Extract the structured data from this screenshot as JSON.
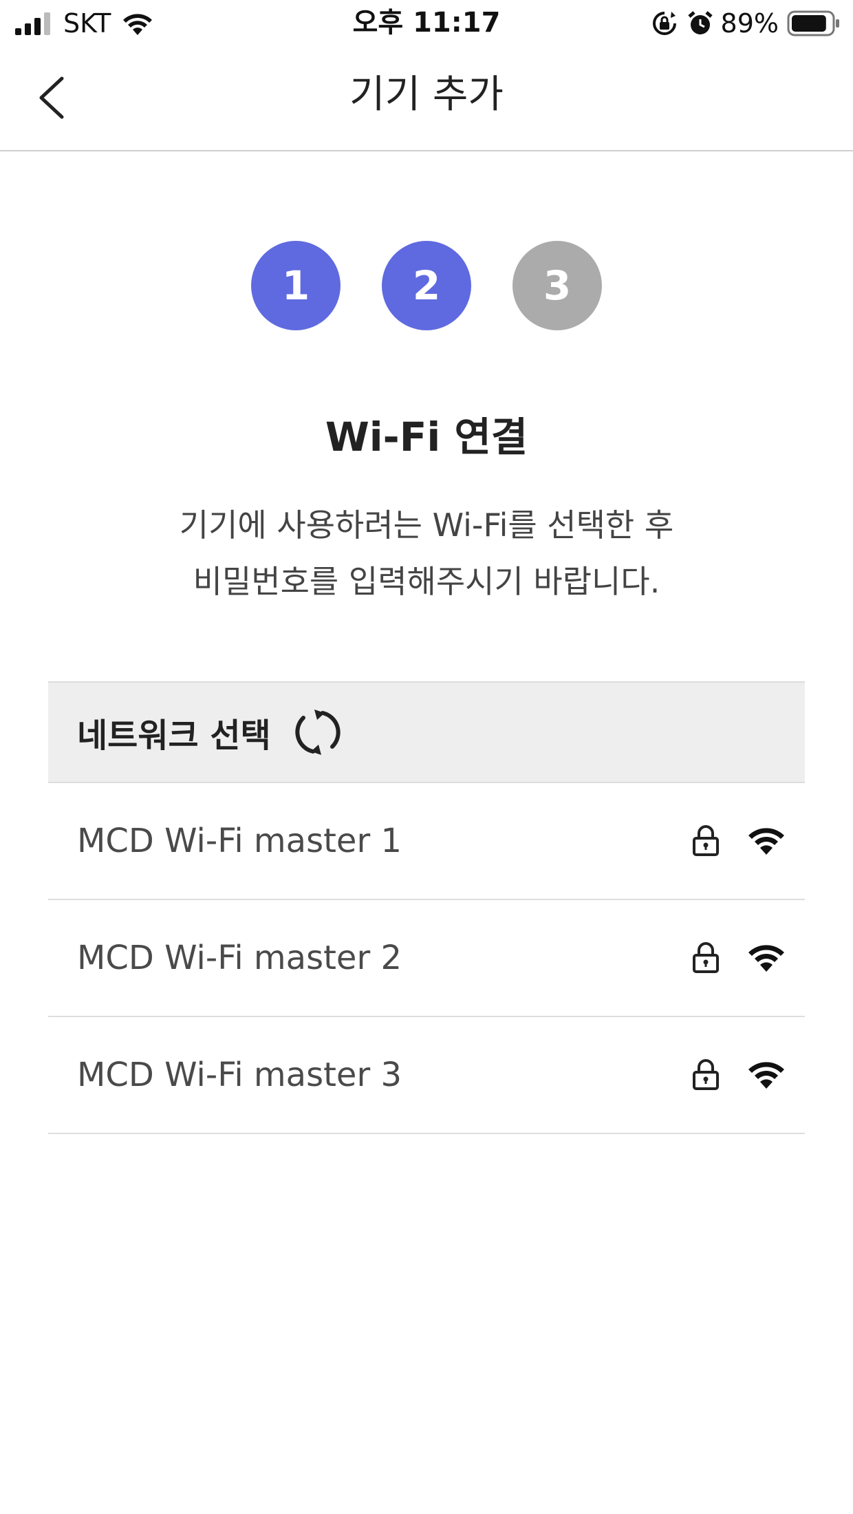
{
  "status_bar": {
    "carrier": "SKT",
    "time": "오후 11:17",
    "battery_percent": "89%",
    "battery_level": 0.89,
    "icons": [
      "signal-icon",
      "wifi-icon",
      "rotation-lock-icon",
      "alarm-icon",
      "battery-icon"
    ]
  },
  "nav": {
    "title": "기기 추가",
    "back_icon": "chevron-left-icon"
  },
  "steps": [
    {
      "label": "1",
      "state": "done",
      "color": "#5f6ae0"
    },
    {
      "label": "2",
      "state": "current",
      "color": "#5f6ae0"
    },
    {
      "label": "3",
      "state": "pending",
      "color": "#ababab"
    }
  ],
  "heading": "Wi-Fi 연결",
  "subtitle": {
    "line1": "기기에 사용하려는 Wi-Fi를 선택한 후",
    "line2": "비밀번호를 입력해주시기 바랍니다."
  },
  "network_section": {
    "header_label": "네트워크 선택",
    "refresh_icon": "refresh-icon",
    "networks": [
      {
        "name": "MCD Wi-Fi master 1",
        "secured": true,
        "signal": "full"
      },
      {
        "name": "MCD Wi-Fi master 2",
        "secured": true,
        "signal": "full"
      },
      {
        "name": "MCD Wi-Fi master 3",
        "secured": true,
        "signal": "full"
      }
    ]
  },
  "colors": {
    "accent": "#5f6ae0",
    "inactive_step": "#ababab",
    "header_bg": "#eeeeee"
  }
}
